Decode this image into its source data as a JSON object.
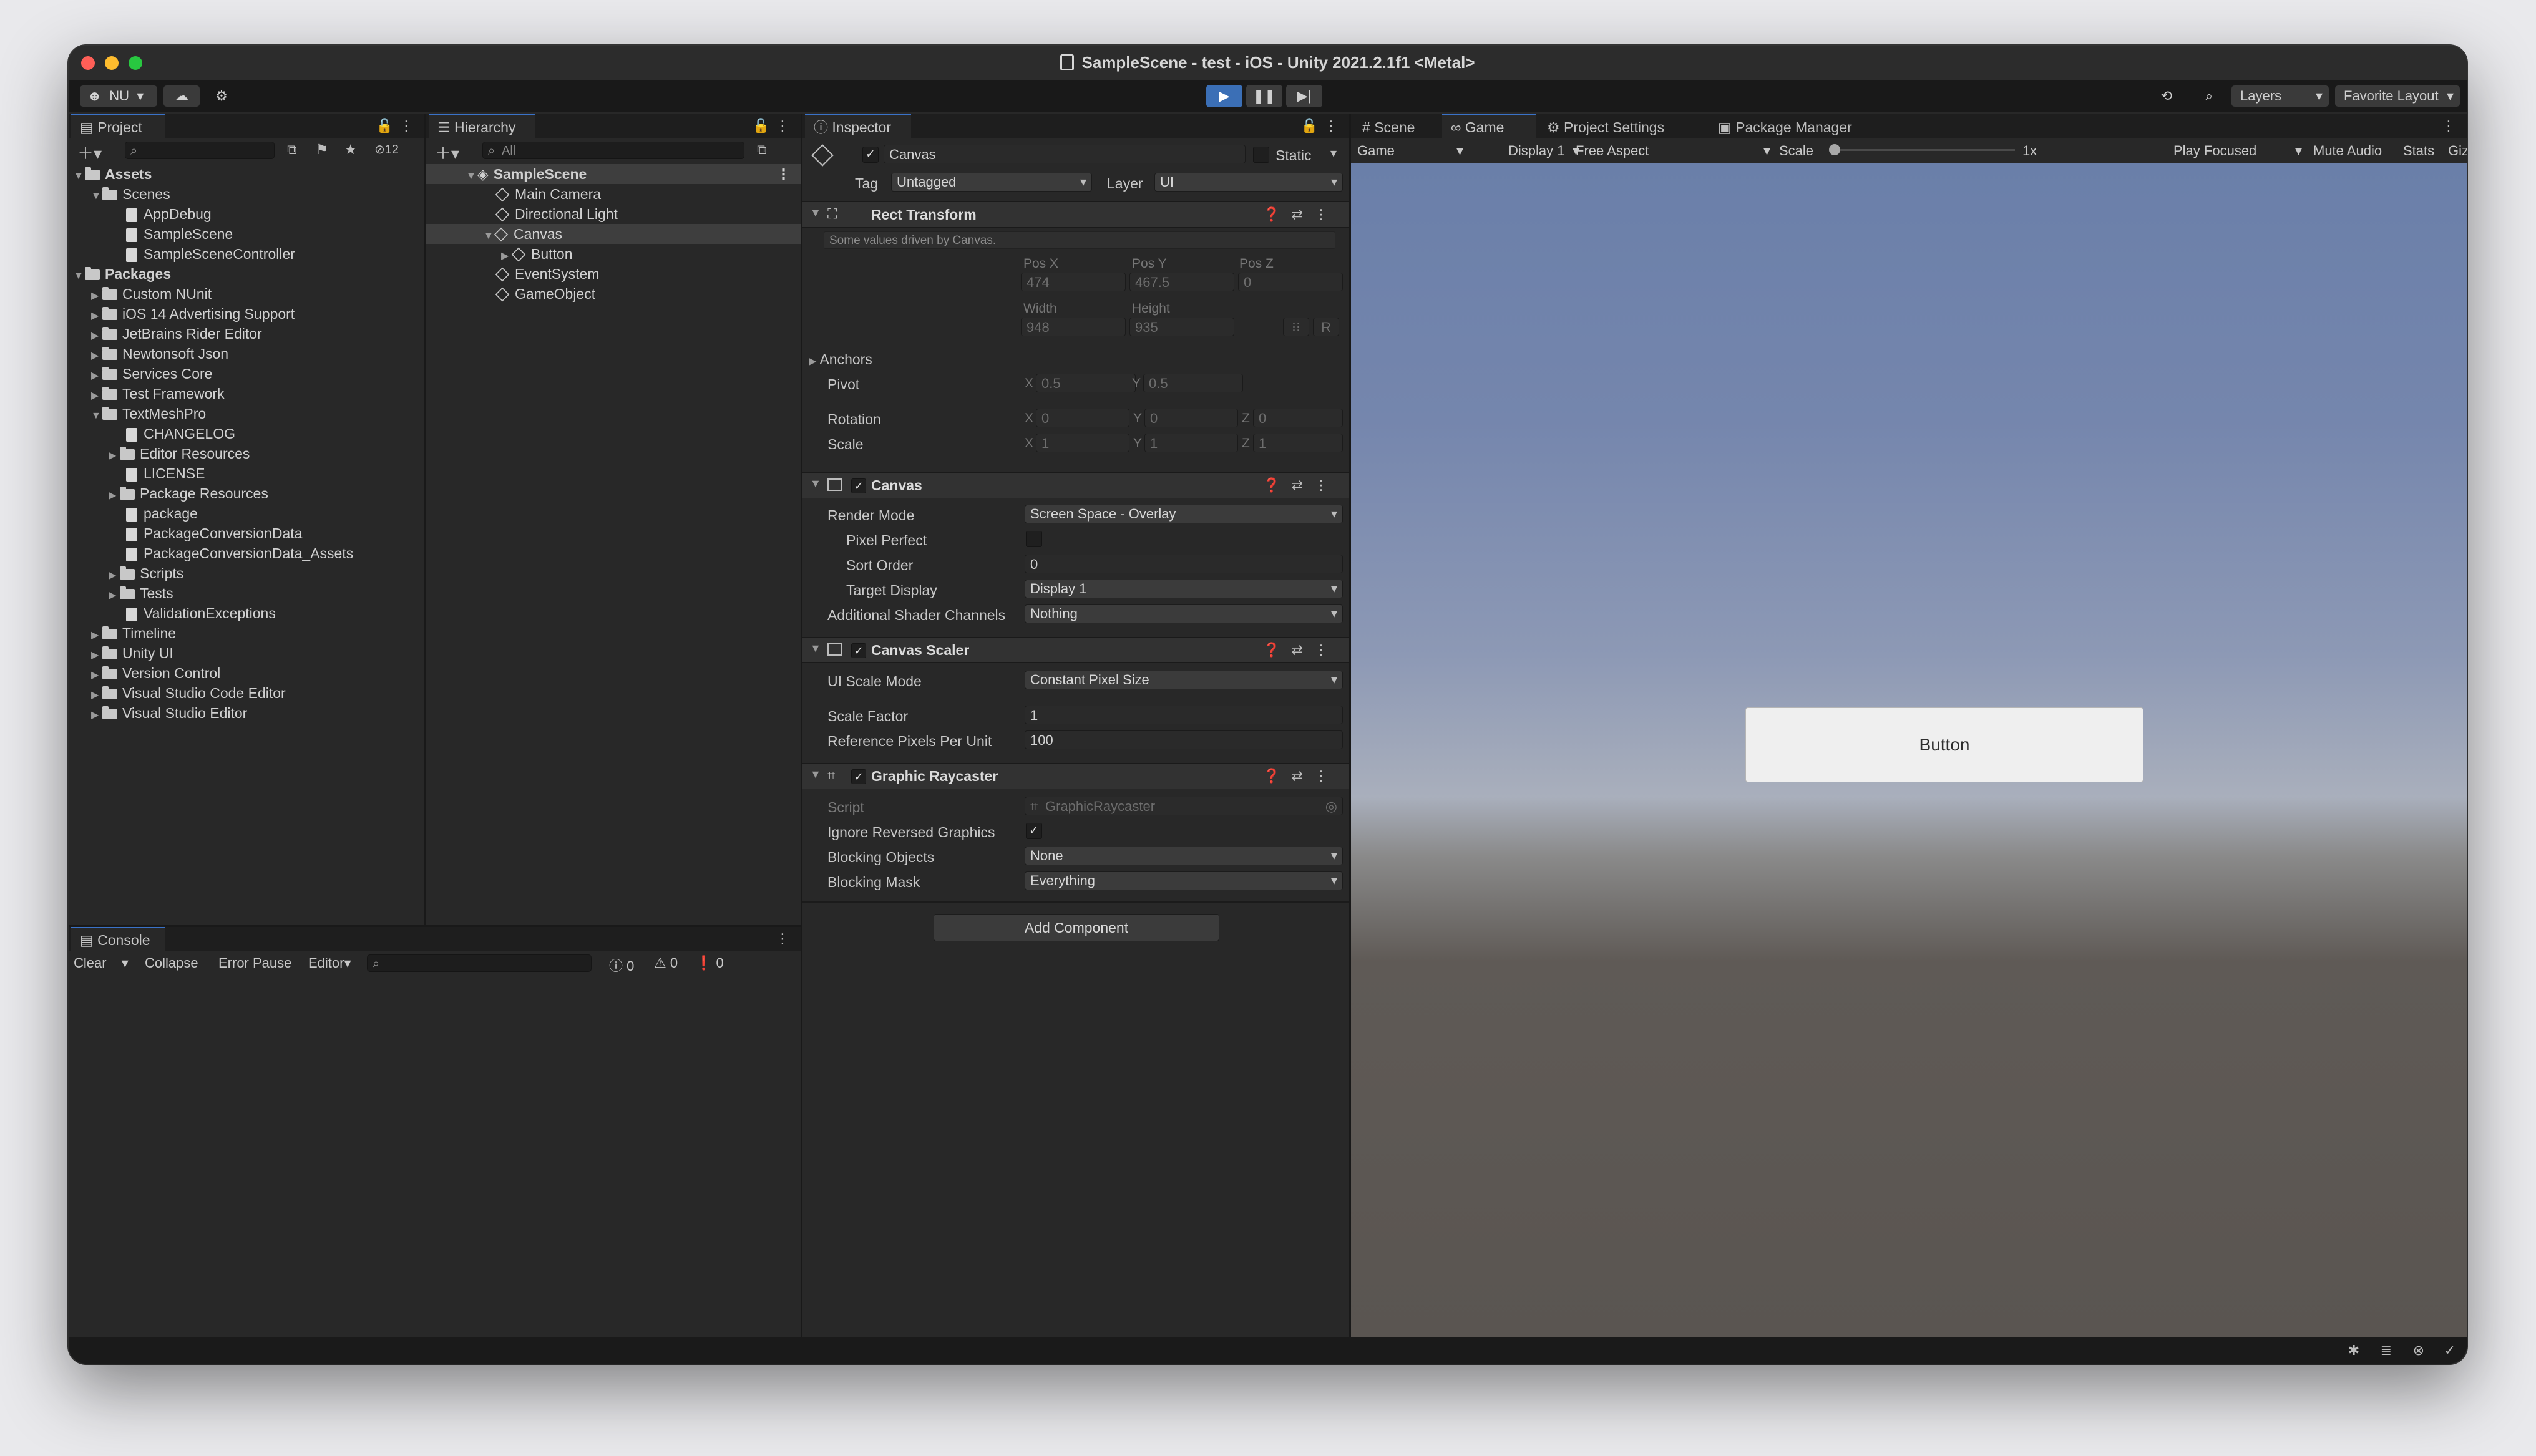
{
  "window": {
    "title": "SampleScene - test - iOS - Unity 2021.2.1f1 <Metal>"
  },
  "toolbar": {
    "account": "NU",
    "layers_label": "Layers",
    "layout_label": "Favorite Layout"
  },
  "project": {
    "tab": "Project",
    "hidden_count": "12",
    "assets_label": "Assets",
    "scenes_label": "Scenes",
    "scene_files": [
      "AppDebug",
      "SampleScene",
      "SampleSceneController"
    ],
    "packages_label": "Packages",
    "packages_a": [
      "Custom NUnit",
      "iOS 14 Advertising Support",
      "JetBrains Rider Editor",
      "Newtonsoft Json",
      "Services Core",
      "Test Framework"
    ],
    "textmeshpro_label": "TextMeshPro",
    "textmeshpro_items": [
      "CHANGELOG",
      "Editor Resources",
      "LICENSE",
      "Package Resources",
      "package",
      "PackageConversionData",
      "PackageConversionData_Assets",
      "Scripts",
      "Tests",
      "ValidationExceptions"
    ],
    "packages_b": [
      "Timeline",
      "Unity UI",
      "Version Control",
      "Visual Studio Code Editor",
      "Visual Studio Editor"
    ]
  },
  "hierarchy": {
    "tab": "Hierarchy",
    "search_placeholder": "All",
    "scene": "SampleScene",
    "items": [
      "Main Camera",
      "Directional Light",
      "Canvas",
      "Button",
      "EventSystem",
      "GameObject"
    ]
  },
  "console": {
    "tab": "Console",
    "clear": "Clear",
    "collapse": "Collapse",
    "error_pause": "Error Pause",
    "editor": "Editor",
    "info_count": "0",
    "warning_count": "0",
    "error_count": "0"
  },
  "inspector": {
    "tab": "Inspector",
    "object_name": "Canvas",
    "static_label": "Static",
    "tag_label": "Tag",
    "tag_value": "Untagged",
    "layer_label": "Layer",
    "layer_value": "UI",
    "rect_transform": {
      "title": "Rect Transform",
      "note": "Some values driven by Canvas.",
      "posx_label": "Pos X",
      "posy_label": "Pos Y",
      "posz_label": "Pos Z",
      "posx": "474",
      "posy": "467.5",
      "posz": "0",
      "width_label": "Width",
      "height_label": "Height",
      "width": "948",
      "height": "935",
      "r_label": "R",
      "anchors_label": "Anchors",
      "pivot_label": "Pivot",
      "pivot_x": "0.5",
      "pivot_y": "0.5",
      "rotation_label": "Rotation",
      "rot_x": "0",
      "rot_y": "0",
      "rot_z": "0",
      "scale_label": "Scale",
      "scale_x": "1",
      "scale_y": "1",
      "scale_z": "1",
      "x": "X",
      "y": "Y",
      "z": "Z"
    },
    "canvas": {
      "title": "Canvas",
      "render_mode_label": "Render Mode",
      "render_mode": "Screen Space - Overlay",
      "pixel_perfect_label": "Pixel Perfect",
      "sort_order_label": "Sort Order",
      "sort_order": "0",
      "target_display_label": "Target Display",
      "target_display": "Display 1",
      "shader_channels_label": "Additional Shader Channels",
      "shader_channels": "Nothing"
    },
    "canvas_scaler": {
      "title": "Canvas Scaler",
      "ui_scale_mode_label": "UI Scale Mode",
      "ui_scale_mode": "Constant Pixel Size",
      "scale_factor_label": "Scale Factor",
      "scale_factor": "1",
      "ref_ppu_label": "Reference Pixels Per Unit",
      "ref_ppu": "100"
    },
    "graphic_raycaster": {
      "title": "Graphic Raycaster",
      "script_label": "Script",
      "script": "GraphicRaycaster",
      "ignore_reversed_label": "Ignore Reversed Graphics",
      "blocking_objects_label": "Blocking Objects",
      "blocking_objects": "None",
      "blocking_mask_label": "Blocking Mask",
      "blocking_mask": "Everything"
    },
    "add_component": "Add Component"
  },
  "game_view": {
    "tabs": [
      "Scene",
      "Game",
      "Project Settings",
      "Package Manager"
    ],
    "mode": "Game",
    "display": "Display 1",
    "aspect": "Free Aspect",
    "scale_label": "Scale",
    "scale_value": "1x",
    "play_focused": "Play Focused",
    "mute_audio": "Mute Audio",
    "stats": "Stats",
    "gizmos": "Gizmos",
    "button_text": "Button"
  },
  "colors": {
    "accent": "#3b6fb6",
    "panel_bg": "#282828",
    "close": "#fe5f57",
    "minimize": "#febc2e",
    "maximize": "#28c840"
  }
}
